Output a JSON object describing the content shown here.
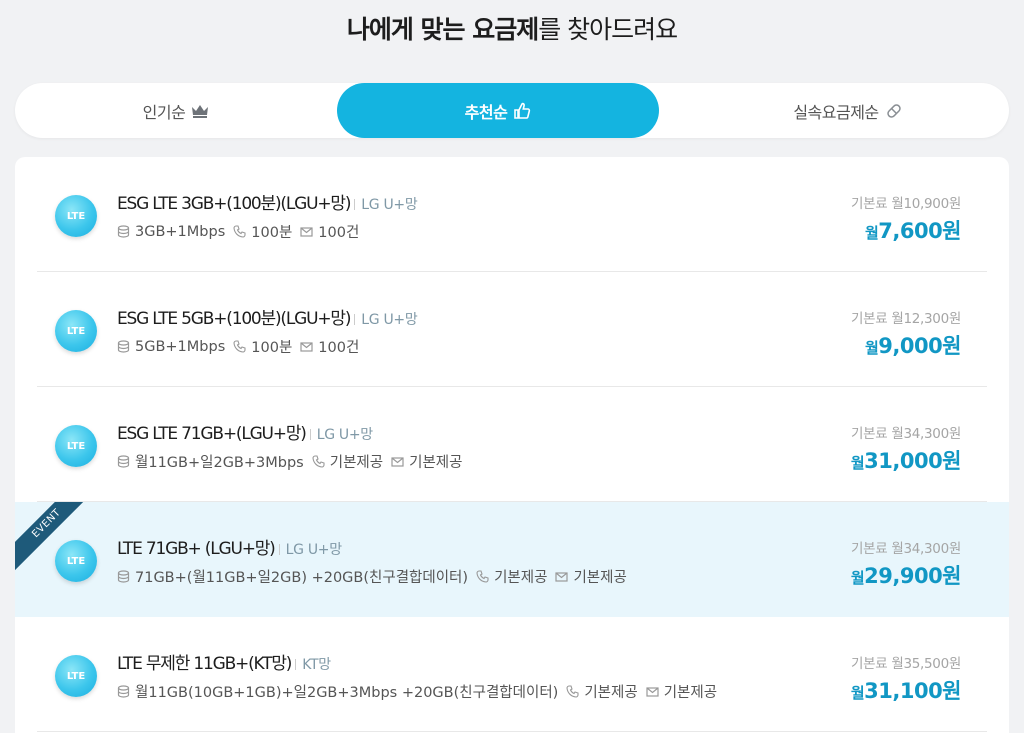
{
  "header": {
    "title_bold": "나에게 맞는 요금제",
    "title_rest": "를 찾아드려요"
  },
  "tabs": [
    {
      "label": "인기순",
      "icon": "crown-icon"
    },
    {
      "label": "추천순",
      "icon": "thumbs-up-icon",
      "active": true
    },
    {
      "label": "실속요금제순",
      "icon": "pill-icon"
    }
  ],
  "colors": {
    "accent": "#14b4e0",
    "price": "#1197c4",
    "event_bg": "#e8f6fc",
    "ribbon": "#1e5a7a"
  },
  "plans": [
    {
      "badge": "LTE",
      "name": "ESG LTE 3GB+(100분)(LGU+망)",
      "carrier": "LG U+망",
      "data": "3GB+1Mbps",
      "voice": "100분",
      "sms": "100건",
      "base_price": "기본료 월10,900원",
      "price_prefix": "월",
      "price": "7,600원"
    },
    {
      "badge": "LTE",
      "name": "ESG LTE 5GB+(100분)(LGU+망)",
      "carrier": "LG U+망",
      "data": "5GB+1Mbps",
      "voice": "100분",
      "sms": "100건",
      "base_price": "기본료 월12,300원",
      "price_prefix": "월",
      "price": "9,000원"
    },
    {
      "badge": "LTE",
      "name": "ESG LTE 71GB+(LGU+망)",
      "carrier": "LG U+망",
      "data": "월11GB+일2GB+3Mbps",
      "voice": "기본제공",
      "sms": "기본제공",
      "base_price": "기본료 월34,300원",
      "price_prefix": "월",
      "price": "31,000원"
    },
    {
      "badge": "LTE",
      "ribbon": "EVENT",
      "name": "LTE 71GB+ (LGU+망)",
      "carrier": "LG U+망",
      "data": "71GB+(월11GB+일2GB) +20GB(친구결합데이터)",
      "voice": "기본제공",
      "sms": "기본제공",
      "base_price": "기본료 월34,300원",
      "price_prefix": "월",
      "price": "29,900원"
    },
    {
      "badge": "LTE",
      "name": "LTE 무제한 11GB+(KT망)",
      "carrier": "KT망",
      "data": "월11GB(10GB+1GB)+일2GB+3Mbps +20GB(친구결합데이터)",
      "voice": "기본제공",
      "sms": "기본제공",
      "base_price": "기본료 월35,500원",
      "price_prefix": "월",
      "price": "31,100원"
    }
  ]
}
